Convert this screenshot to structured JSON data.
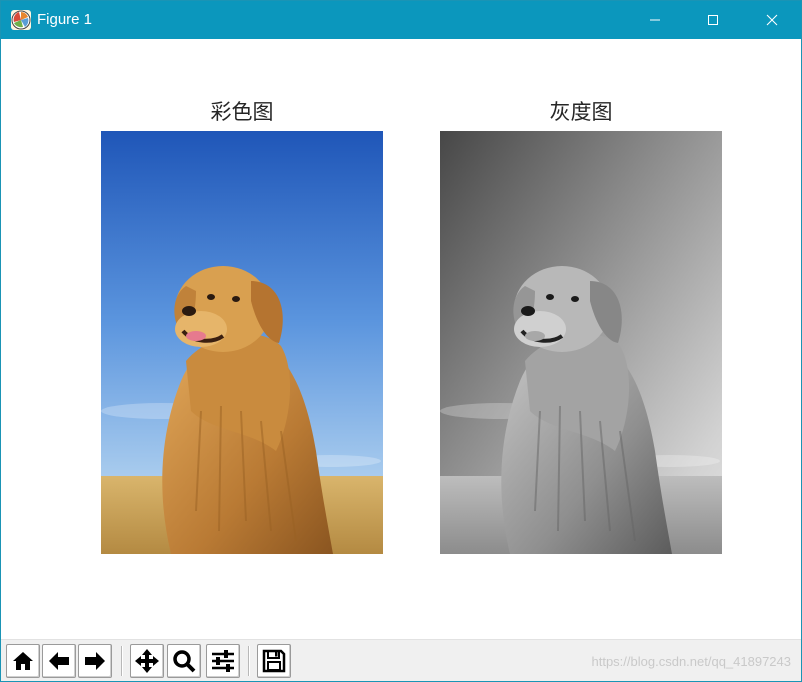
{
  "window": {
    "title": "Figure 1",
    "icon": "matplotlib-icon",
    "controls": {
      "minimize": "minimize-icon",
      "maximize": "maximize-icon",
      "close": "close-icon"
    },
    "titlebar_color": "#0b97bd"
  },
  "figure": {
    "subplots": [
      {
        "title": "彩色图",
        "image": "golden-retriever-color"
      },
      {
        "title": "灰度图",
        "image": "golden-retriever-grayscale"
      }
    ]
  },
  "toolbar": {
    "buttons": [
      {
        "name": "home",
        "icon": "home-icon"
      },
      {
        "name": "back",
        "icon": "arrow-left-icon"
      },
      {
        "name": "forward",
        "icon": "arrow-right-icon"
      },
      {
        "name": "pan",
        "icon": "move-icon"
      },
      {
        "name": "zoom",
        "icon": "magnifier-icon"
      },
      {
        "name": "configure-subplots",
        "icon": "sliders-icon"
      },
      {
        "name": "save",
        "icon": "floppy-disk-icon"
      }
    ],
    "watermark": "https://blog.csdn.net/qq_41897243"
  }
}
